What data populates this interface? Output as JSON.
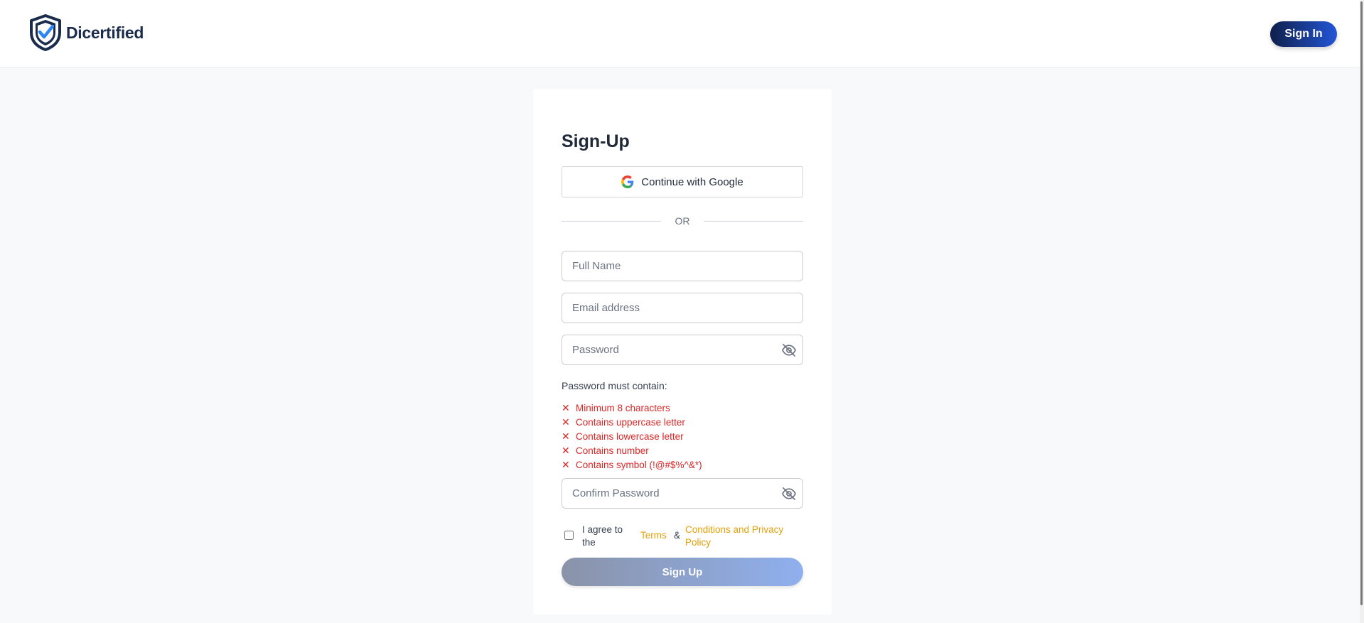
{
  "header": {
    "brand": "Dicertified",
    "logo_icon": "shield-check-icon",
    "signin_label": "Sign In"
  },
  "form": {
    "title": "Sign-Up",
    "google_label": "Continue with Google",
    "or_label": "OR",
    "full_name": {
      "value": "",
      "placeholder": "Full Name"
    },
    "email": {
      "value": "",
      "placeholder": "Email address"
    },
    "password": {
      "value": "",
      "placeholder": "Password",
      "toggle_icon": "eye-off-icon"
    },
    "requirements_title": "Password must contain:",
    "requirements": [
      {
        "label": "Minimum 8 characters",
        "met": false,
        "icon": "x-icon"
      },
      {
        "label": "Contains uppercase letter",
        "met": false,
        "icon": "x-icon"
      },
      {
        "label": "Contains lowercase letter",
        "met": false,
        "icon": "x-icon"
      },
      {
        "label": "Contains number",
        "met": false,
        "icon": "x-icon"
      },
      {
        "label": "Contains symbol (!@#$%^&*)",
        "met": false,
        "icon": "x-icon"
      }
    ],
    "confirm_password": {
      "value": "",
      "placeholder": "Confirm Password",
      "toggle_icon": "eye-off-icon"
    },
    "agree": {
      "checked": false,
      "text": "I agree to the",
      "terms_label": "Terms",
      "ampersand": "&",
      "conditions_label": "Conditions and Privacy Policy"
    },
    "submit_label": "Sign Up"
  },
  "colors": {
    "brand_navy": "#1a2b4c",
    "accent_blue": "#2355d6",
    "error_red": "#dc2626",
    "link_gold": "#e3a008"
  }
}
